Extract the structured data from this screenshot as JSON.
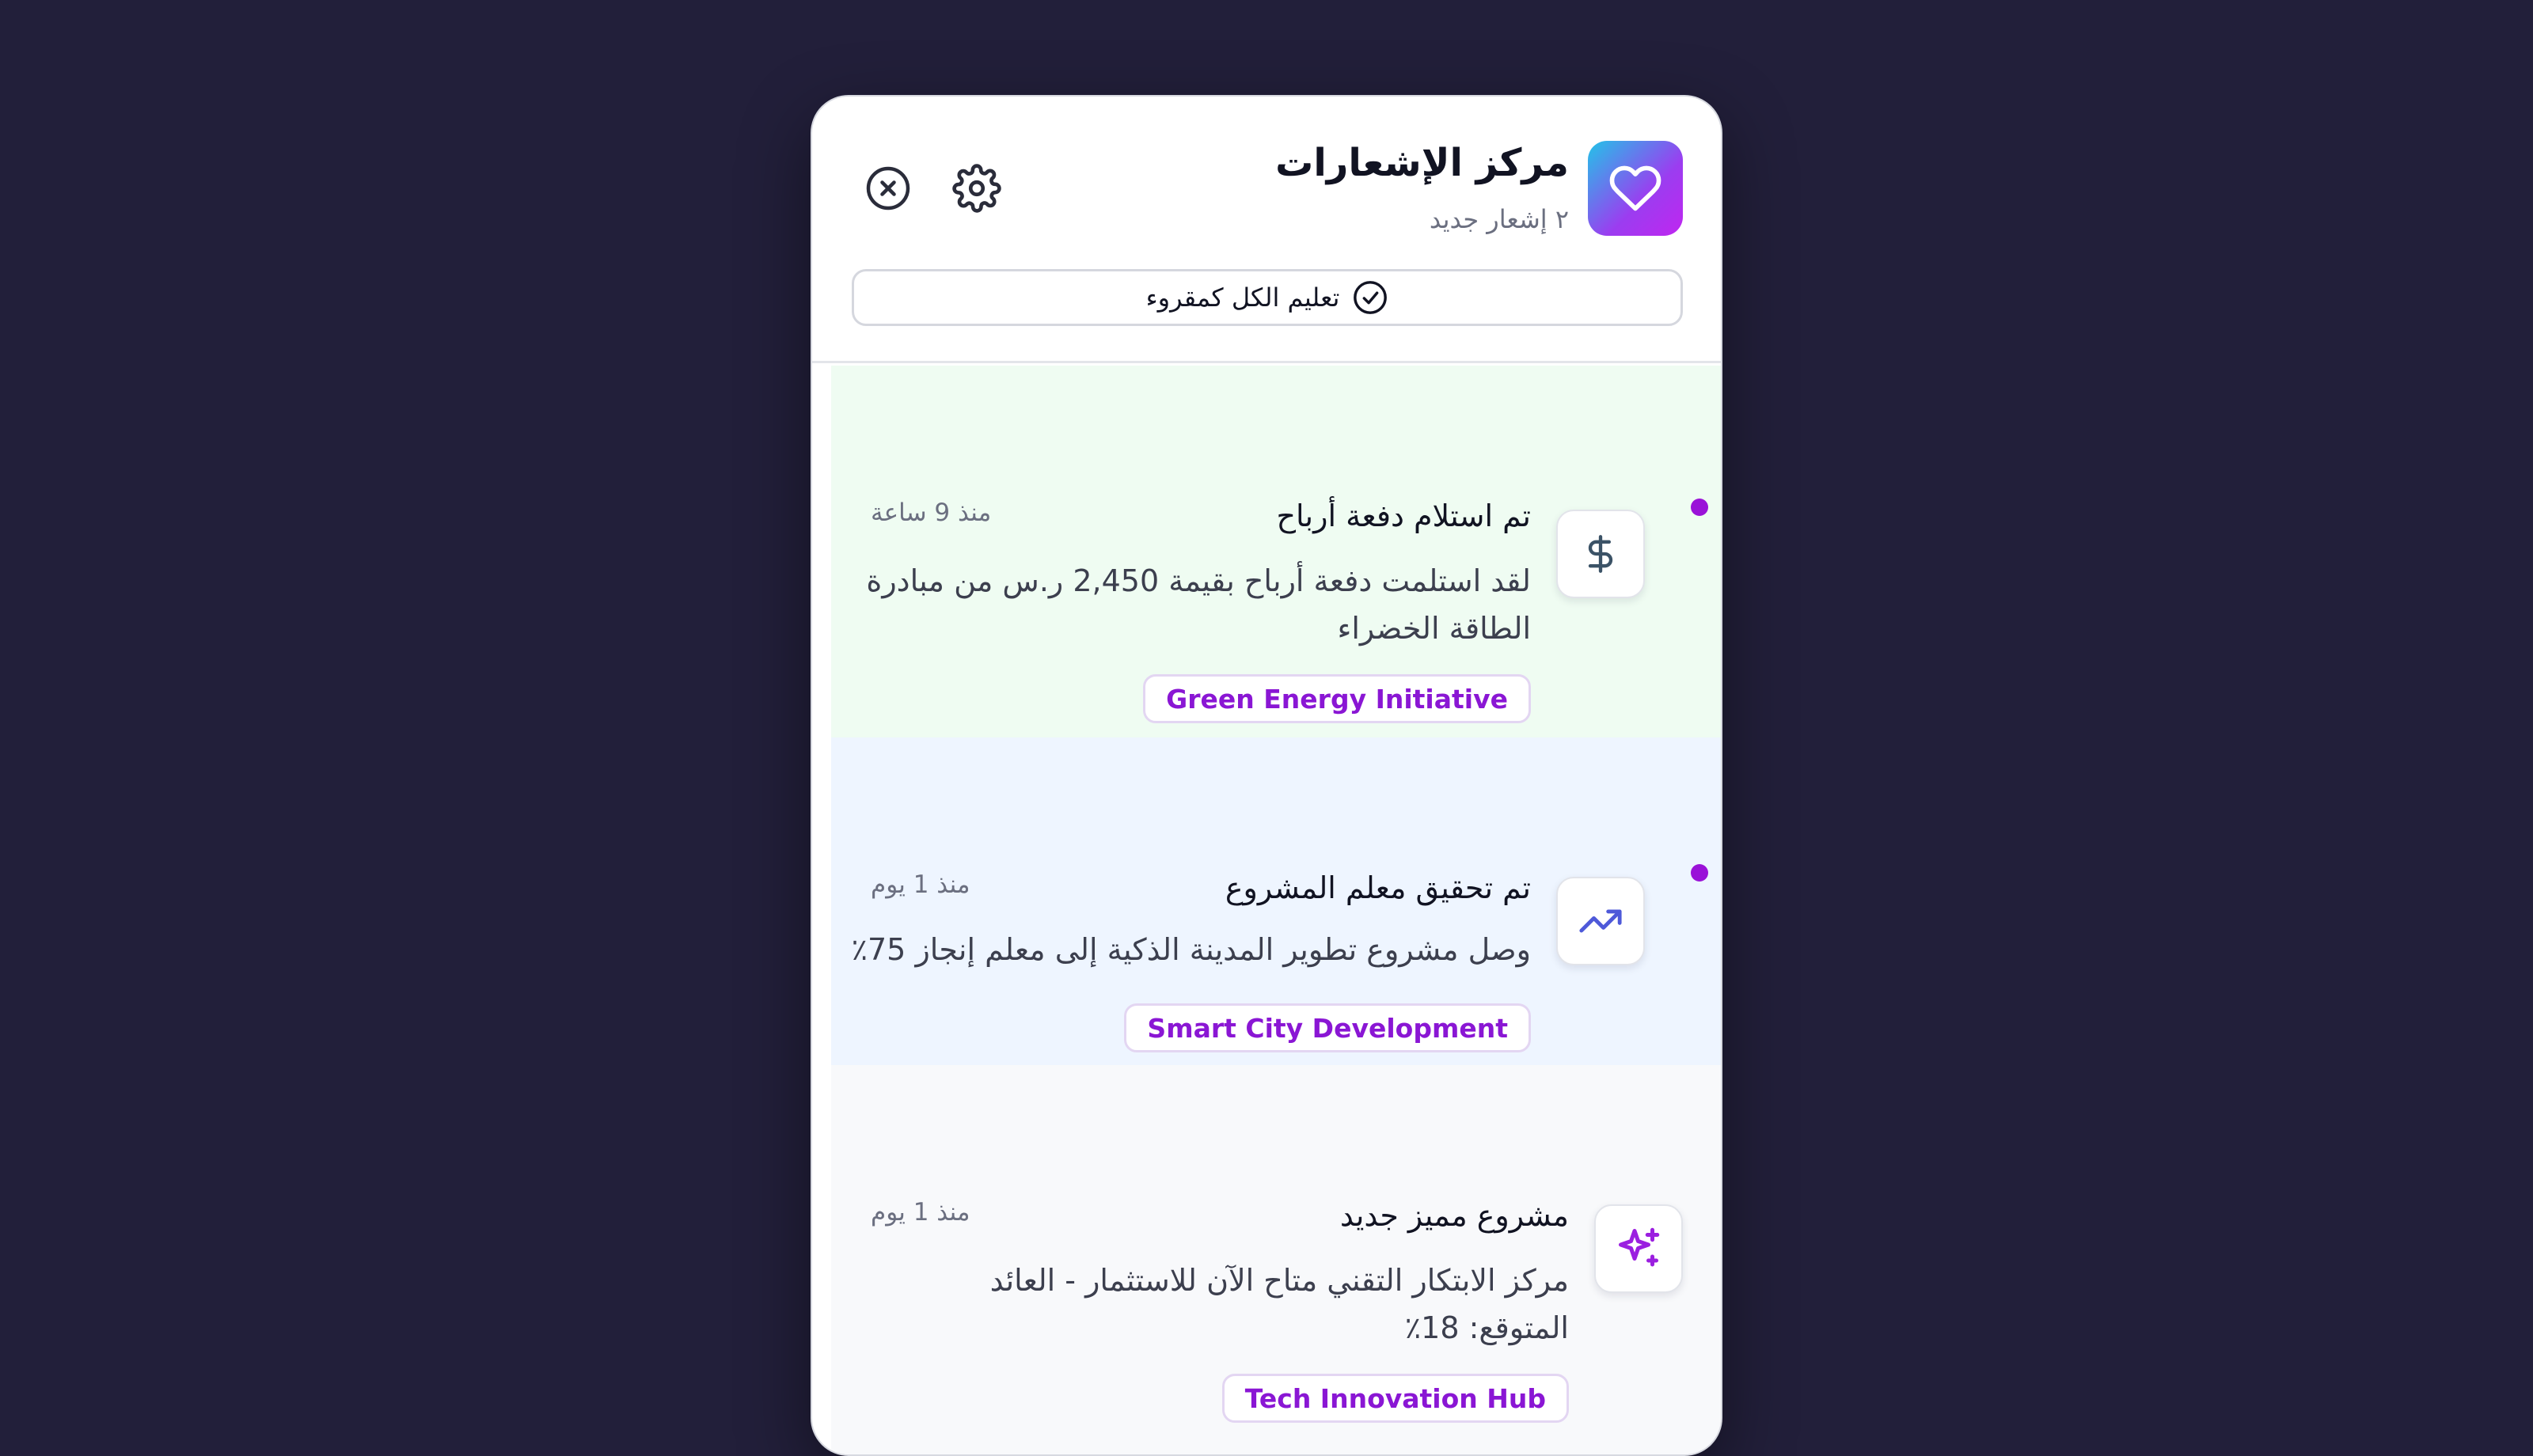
{
  "header": {
    "title": "مركز الإشعارات",
    "subtitle": "٢ إشعار جديد",
    "mark_all_label": "تعليم الكل كمقروء",
    "logo_icon": "heart-icon",
    "close_icon": "close-circle-icon",
    "settings_icon": "gear-icon"
  },
  "colors": {
    "background": "#221f3a",
    "accent": "#9a12d8",
    "unread_green": "#effcf2",
    "unread_blue": "#eef5ff",
    "read_gray": "#f8f9fb"
  },
  "notifications": [
    {
      "title": "تم استلام دفعة أرباح",
      "time": "منذ 9 ساعة",
      "body": "لقد استلمت دفعة أرباح بقيمة 2,450 ر.س من مبادرة الطاقة الخضراء",
      "tag": "Green Energy Initiative",
      "icon": "dollar-icon",
      "unread": true
    },
    {
      "title": "تم تحقيق معلم المشروع",
      "time": "منذ 1 يوم",
      "body": "وصل مشروع تطوير المدينة الذكية إلى معلم إنجاز 75٪",
      "tag": "Smart City Development",
      "icon": "trending-up-icon",
      "unread": true
    },
    {
      "title": "مشروع مميز جديد",
      "time": "منذ 1 يوم",
      "body": "مركز الابتكار التقني متاح الآن للاستثمار - العائد المتوقع: 18٪",
      "tag": "Tech Innovation Hub",
      "icon": "sparkles-icon",
      "unread": false
    }
  ]
}
